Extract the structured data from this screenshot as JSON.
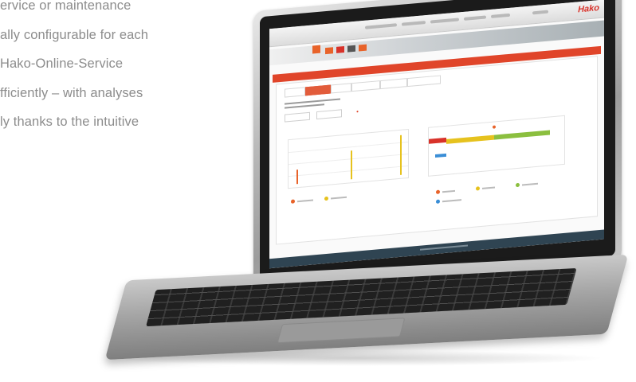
{
  "copy_lines": [
    "ervice or maintenance",
    "ally configurable for each",
    "Hako-Online-Service",
    "fficiently – with analyses",
    "ly thanks to the intuitive"
  ],
  "screen": {
    "logo": "Hako",
    "colors": {
      "accent": "#e0452a",
      "orange": "#e8632a",
      "yellow": "#e6c21e",
      "green": "#8bbf3f",
      "blue": "#3a8ed6",
      "footer": "#2f4452"
    }
  }
}
